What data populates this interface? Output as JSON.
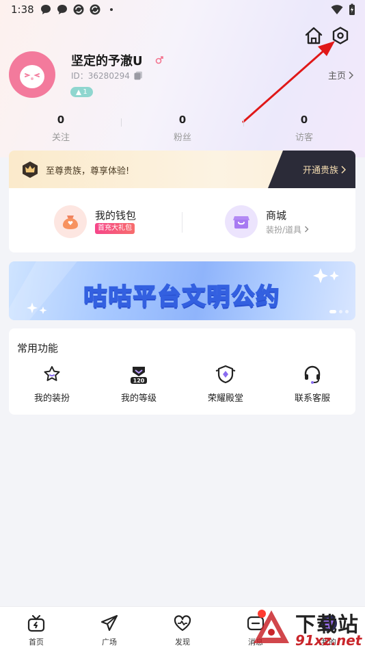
{
  "status_bar": {
    "time": "1:38"
  },
  "profile": {
    "username": "坚定的予澈U",
    "user_id": "ID：36280294",
    "level": "1",
    "homepage_label": "主页"
  },
  "stats": [
    {
      "value": "0",
      "label": "关注"
    },
    {
      "value": "0",
      "label": "粉丝"
    },
    {
      "value": "0",
      "label": "访客"
    }
  ],
  "vip": {
    "text": "至尊贵族，尊享体验!",
    "button": "开通贵族"
  },
  "wallet": {
    "title": "我的钱包",
    "tag": "首充大礼包"
  },
  "mall": {
    "title": "商城",
    "subtitle": "装扮/道具"
  },
  "banner": {
    "title": "咕咕平台文明公约"
  },
  "functions": {
    "title": "常用功能",
    "items": [
      {
        "label": "我的装扮",
        "icon": "dress-star-icon"
      },
      {
        "label": "我的等级",
        "icon": "level-badge-icon"
      },
      {
        "label": "荣耀殿堂",
        "icon": "honor-shield-icon"
      },
      {
        "label": "联系客服",
        "icon": "headset-icon"
      }
    ]
  },
  "nav": [
    {
      "label": "首页",
      "icon": "tv-icon"
    },
    {
      "label": "广场",
      "icon": "paper-plane-icon"
    },
    {
      "label": "发现",
      "icon": "heartbeat-icon"
    },
    {
      "label": "消息",
      "icon": "message-icon"
    },
    {
      "label": "我的",
      "icon": "avatar-icon"
    }
  ],
  "watermark": {
    "big": "下载站",
    "small": "91xz.net"
  },
  "colors": {
    "accent_pink": "#f37a9c",
    "vip_dark": "#2b2b38",
    "banner_blue": "#3360e0"
  }
}
